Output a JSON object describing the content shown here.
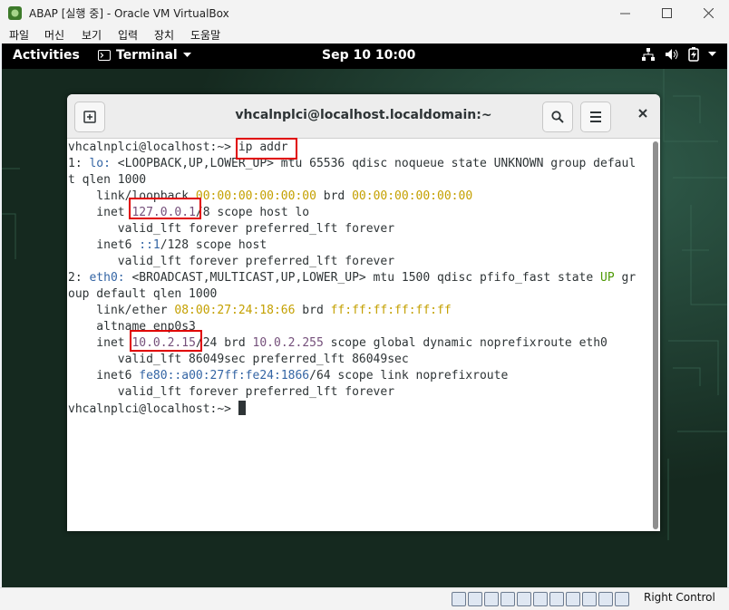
{
  "vbox": {
    "title": "ABAP [실행 중] - Oracle VM VirtualBox",
    "menu": [
      "파일",
      "머신",
      "보기",
      "입력",
      "장치",
      "도움말"
    ],
    "host_key": "Right Control"
  },
  "gnome": {
    "activities": "Activities",
    "app_name": "Terminal",
    "clock": "Sep 10  10:00"
  },
  "terminal": {
    "title": "vhcalnplci@localhost.localdomain:~",
    "prompt": "vhcalnplci@localhost:~> ",
    "command": "ip addr",
    "lo": {
      "index": "1:",
      "name": "lo:",
      "flags": " <LOOPBACK,UP,LOWER_UP> mtu 65536 qdisc noqueue state UNKNOWN group defaul",
      "flags_wrap": "t qlen 1000",
      "link_label": "    link/loopback ",
      "mac": "00:00:00:00:00:00",
      "brd": " brd ",
      "brd_mac": "00:00:00:00:00:00",
      "inet_label": "    inet ",
      "ipv4": "127.0.0.1",
      "inet_rest": "/8 scope host lo",
      "lft1": "       valid_lft forever preferred_lft forever",
      "inet6_label": "    inet6 ",
      "ipv6": "::1",
      "inet6_rest": "/128 scope host",
      "lft2": "       valid_lft forever preferred_lft forever"
    },
    "eth0": {
      "index": "2:",
      "name": "eth0:",
      "flags": " <BROADCAST,MULTICAST,UP,LOWER_UP> mtu 1500 qdisc pfifo_fast state ",
      "state": "UP",
      "flags_end": " gr",
      "flags_wrap": "oup default qlen 1000",
      "link_label": "    link/ether ",
      "mac": "08:00:27:24:18:66",
      "brd": " brd ",
      "brd_mac": "ff:ff:ff:ff:ff:ff",
      "altname": "    altname enp0s3",
      "inet_label": "    inet ",
      "ipv4": "10.0.2.15",
      "inet_mid": "/24 brd ",
      "brd_ip": "10.0.2.255",
      "inet_rest": " scope global dynamic noprefixroute eth0",
      "lft1": "       valid_lft 86049sec preferred_lft 86049sec",
      "inet6_label": "    inet6 ",
      "ipv6": "fe80::a00:27ff:fe24:1866",
      "inet6_rest": "/64 scope link noprefixroute",
      "lft2": "       valid_lft forever preferred_lft forever"
    },
    "final_prompt": "vhcalnplci@localhost:~> "
  }
}
